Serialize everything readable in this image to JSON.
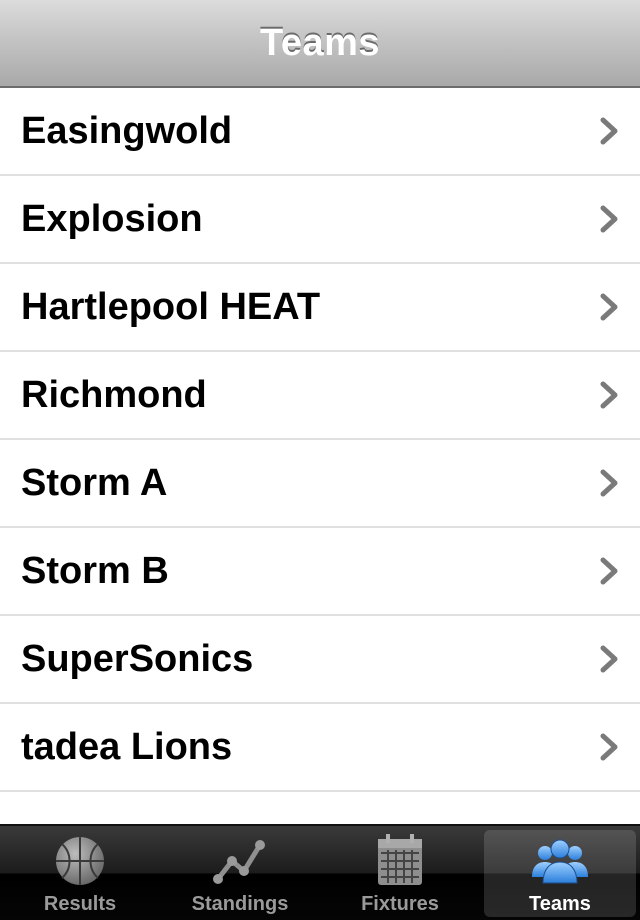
{
  "navbar": {
    "title": "Teams"
  },
  "teams": [
    "Easingwold",
    "Explosion",
    "Hartlepool HEAT",
    "Richmond",
    "Storm A",
    "Storm B",
    "SuperSonics",
    "tadea Lions"
  ],
  "tabbar": {
    "selected": "Teams",
    "tabs": [
      {
        "label": "Results",
        "icon": "basketball-icon"
      },
      {
        "label": "Standings",
        "icon": "line-chart-icon"
      },
      {
        "label": "Fixtures",
        "icon": "calendar-icon"
      },
      {
        "label": "Teams",
        "icon": "people-icon"
      }
    ]
  },
  "colors": {
    "tab_selected_icon": "#3b8ee6",
    "tab_icon": "#9a9a9a"
  }
}
